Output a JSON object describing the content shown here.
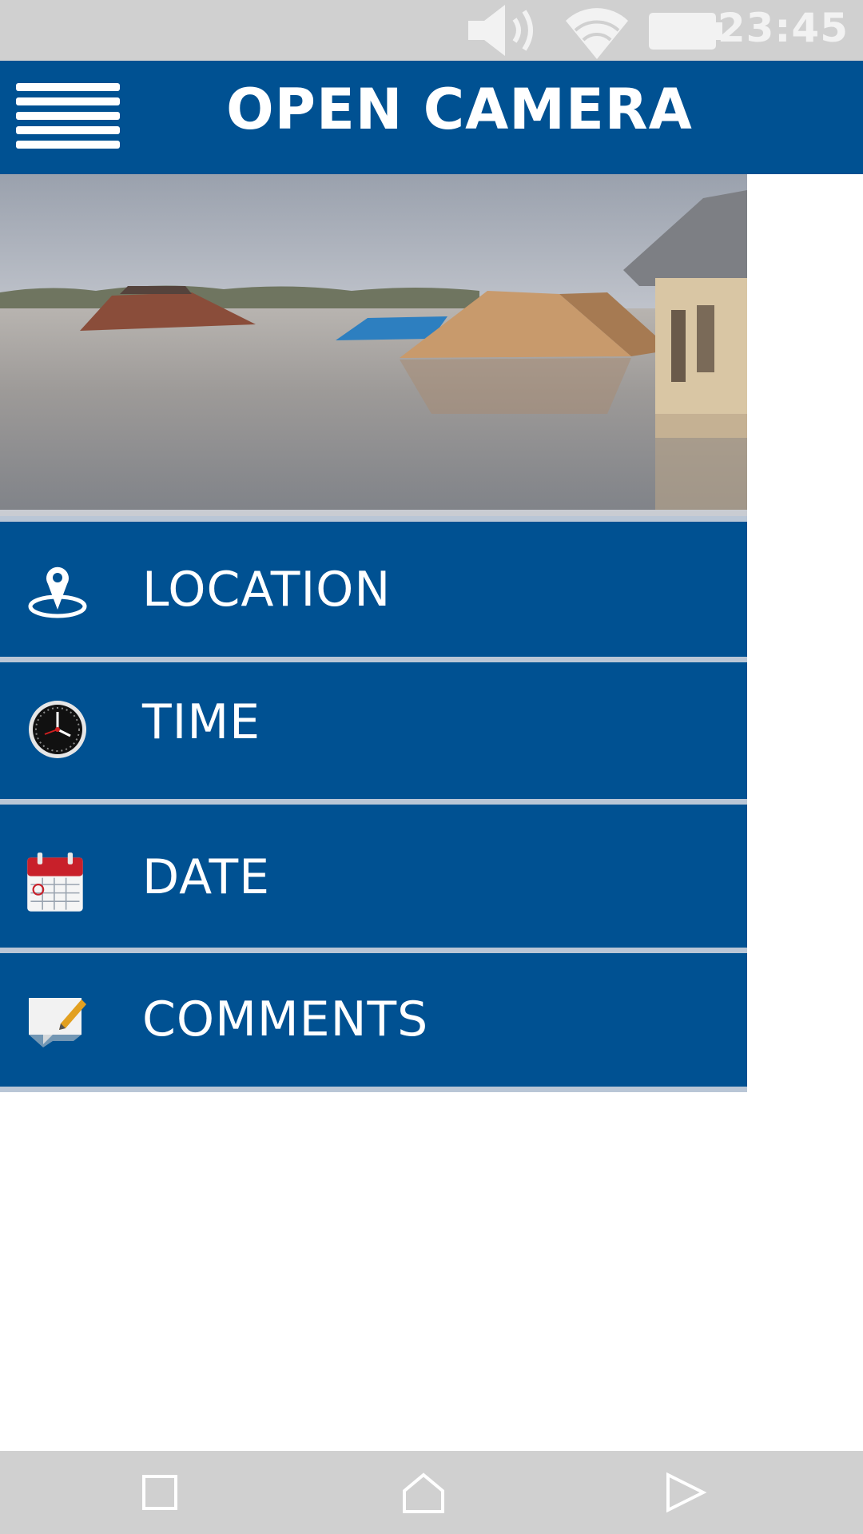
{
  "status_bar": {
    "time": "23:45",
    "icons": [
      "volume-icon",
      "wifi-icon",
      "battery-icon"
    ]
  },
  "header": {
    "title": "OPEN CAMERA",
    "menu_icon": "hamburger-menu-icon",
    "background_color": "#005192"
  },
  "drawer": {
    "image": "flooded-houses-photo",
    "items": [
      {
        "label": "LOCATION",
        "icon": "location-pin-icon"
      },
      {
        "label": "TIME",
        "icon": "clock-icon"
      },
      {
        "label": "DATE",
        "icon": "calendar-icon"
      },
      {
        "label": "COMMENTS",
        "icon": "comment-edit-icon"
      }
    ],
    "item_color": "#005192",
    "divider_color": "#b9c6d6"
  },
  "nav_bar": {
    "buttons": [
      "recents-square-icon",
      "home-icon",
      "back-triangle-icon"
    ]
  }
}
